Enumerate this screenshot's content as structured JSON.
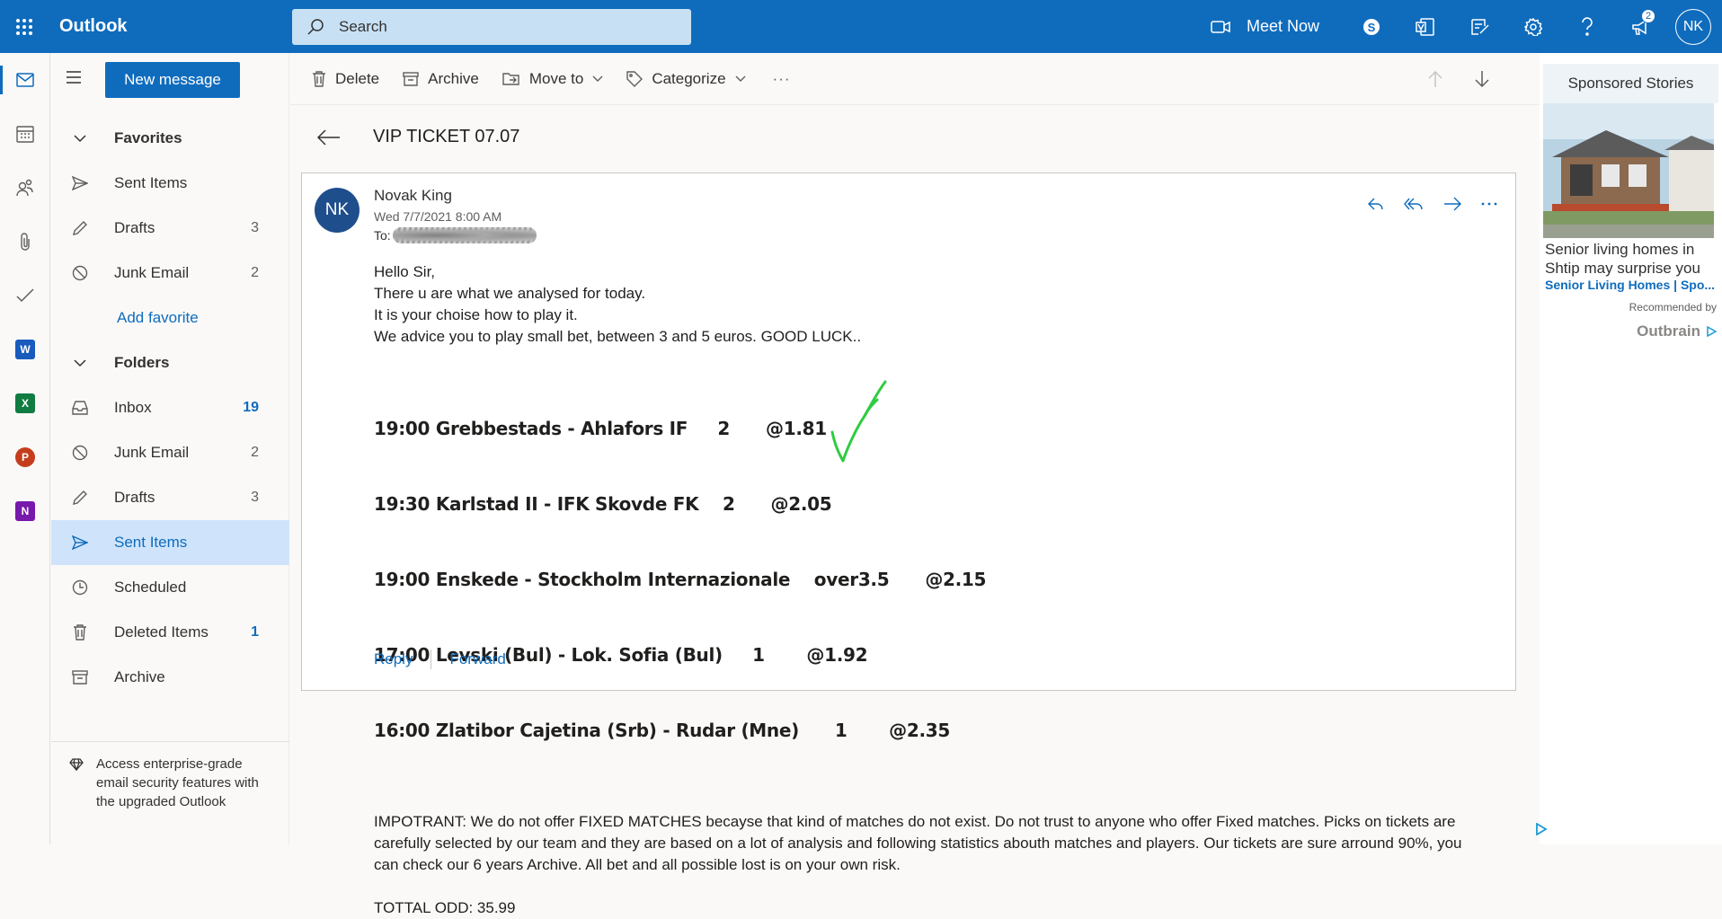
{
  "app": {
    "name": "Outlook",
    "accent": "#0f6cbd"
  },
  "search": {
    "placeholder": "Search"
  },
  "topbar": {
    "meet_now": "Meet Now",
    "notification_count": "2",
    "user_initials": "NK"
  },
  "compose": {
    "new_message": "New message"
  },
  "folders": {
    "favorites_header": "Favorites",
    "favorites": [
      {
        "label": "Sent Items",
        "count": ""
      },
      {
        "label": "Drafts",
        "count": "3"
      },
      {
        "label": "Junk Email",
        "count": "2"
      }
    ],
    "add_favorite": "Add favorite",
    "folders_header": "Folders",
    "items": [
      {
        "label": "Inbox",
        "count": "19"
      },
      {
        "label": "Junk Email",
        "count": "2"
      },
      {
        "label": "Drafts",
        "count": "3"
      },
      {
        "label": "Sent Items",
        "count": ""
      },
      {
        "label": "Scheduled",
        "count": ""
      },
      {
        "label": "Deleted Items",
        "count": "1"
      },
      {
        "label": "Archive",
        "count": ""
      }
    ],
    "upsell": "Access enterprise-grade email security features with the upgraded Outlook"
  },
  "toolbar": {
    "delete": "Delete",
    "archive": "Archive",
    "move_to": "Move to",
    "categorize": "Categorize",
    "more": "···"
  },
  "message": {
    "subject": "VIP TICKET 07.07",
    "sender_initials": "NK",
    "sender_name": "Novak King",
    "date": "Wed 7/7/2021 8:00 AM",
    "to_label": "To:",
    "greeting": "Hello Sir,",
    "lines": [
      "There u are what we analysed for today.",
      "It is your choise how to play it.",
      "We advice you to play small bet, between 3 and 5 euros. GOOD LUCK.."
    ],
    "picks": [
      "19:00 Grebbestads - Ahlafors IF     2      @1.81",
      "19:30 Karlstad II - IFK Skovde FK    2      @2.05",
      "19:00 Enskede - Stockholm Internazionale    over3.5      @2.15",
      "17:00 Levski (Bul) - Lok. Sofia (Bul)     1       @1.92",
      "16:00 Zlatibor Cajetina (Srb) - Rudar (Mne)      1       @2.35"
    ],
    "important": "IMPOTRANT: We do not offer FIXED MATCHES becayse that kind of matches do not exist. Do not trust to anyone who offer Fixed matches. Picks on tickets are carefully selected by our team and they are based on a lot of analysis and following statistics abouth matches and players. Our tickets are sure arround 90%, you can check our 6 years Archive. All bet and all possible lost is on your own risk.",
    "total": "TOTTAL ODD: 35.99",
    "reply": "Reply",
    "forward": "Forward"
  },
  "ad": {
    "header": "Sponsored Stories",
    "text": "Senior living homes in Shtip may surprise you",
    "source": "Senior Living Homes | Spo...",
    "recommended": "Recommended by",
    "brand": "Outbrain"
  }
}
